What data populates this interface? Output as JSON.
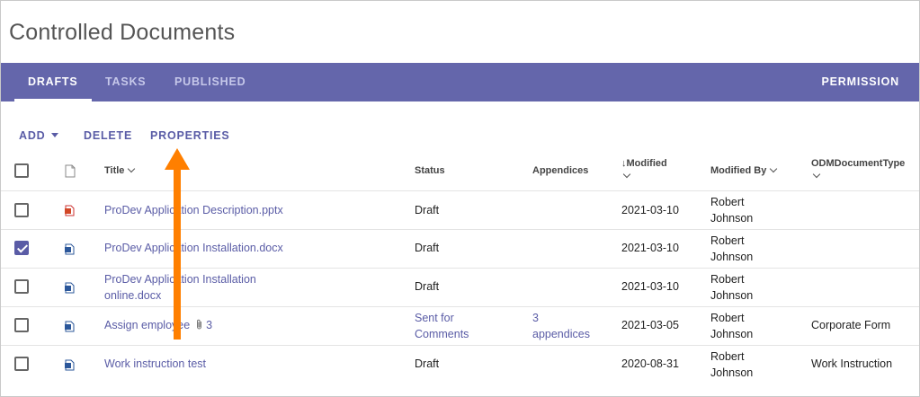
{
  "page": {
    "title": "Controlled Documents"
  },
  "tabs": [
    {
      "label": "DRAFTS",
      "active": true
    },
    {
      "label": "TASKS",
      "active": false
    },
    {
      "label": "PUBLISHED",
      "active": false
    }
  ],
  "permission_label": "PERMISSION",
  "toolbar": {
    "add": "ADD",
    "delete": "DELETE",
    "properties": "PROPERTIES"
  },
  "columns": {
    "title": "Title",
    "status": "Status",
    "appendices": "Appendices",
    "modified": "Modified",
    "modified_by": "Modified By",
    "doc_type": "ODMDocumentType"
  },
  "rows": [
    {
      "checked": false,
      "file_icon": "powerpoint-file-icon",
      "title": "ProDev Application Description.pptx",
      "attach_count": "",
      "status": "Draft",
      "appendices": "",
      "modified": "2021-03-10",
      "modified_by": "Robert Johnson",
      "doc_type": ""
    },
    {
      "checked": true,
      "file_icon": "word-file-icon",
      "title": "ProDev Application Installation.docx",
      "attach_count": "",
      "status": "Draft",
      "appendices": "",
      "modified": "2021-03-10",
      "modified_by": "Robert Johnson",
      "doc_type": ""
    },
    {
      "checked": false,
      "file_icon": "word-file-icon",
      "title": "ProDev Application Installation online.docx",
      "attach_count": "",
      "status": "Draft",
      "appendices": "",
      "modified": "2021-03-10",
      "modified_by": "Robert Johnson",
      "doc_type": ""
    },
    {
      "checked": false,
      "file_icon": "word-file-icon",
      "title": "Assign employee",
      "attach_count": "3",
      "status": "Sent for Comments",
      "appendices": "3 appendices",
      "modified": "2021-03-05",
      "modified_by": "Robert Johnson",
      "doc_type": "Corporate Form"
    },
    {
      "checked": false,
      "file_icon": "word-file-icon",
      "title": "Work instruction test",
      "attach_count": "",
      "status": "Draft",
      "appendices": "",
      "modified": "2020-08-31",
      "modified_by": "Robert Johnson",
      "doc_type": "Work Instruction"
    }
  ],
  "colors": {
    "header_bar": "#6466ab",
    "accent": "#5a5ca6",
    "annotation_arrow": "#ff7f00",
    "powerpoint": "#d24726",
    "word": "#2b579a"
  }
}
